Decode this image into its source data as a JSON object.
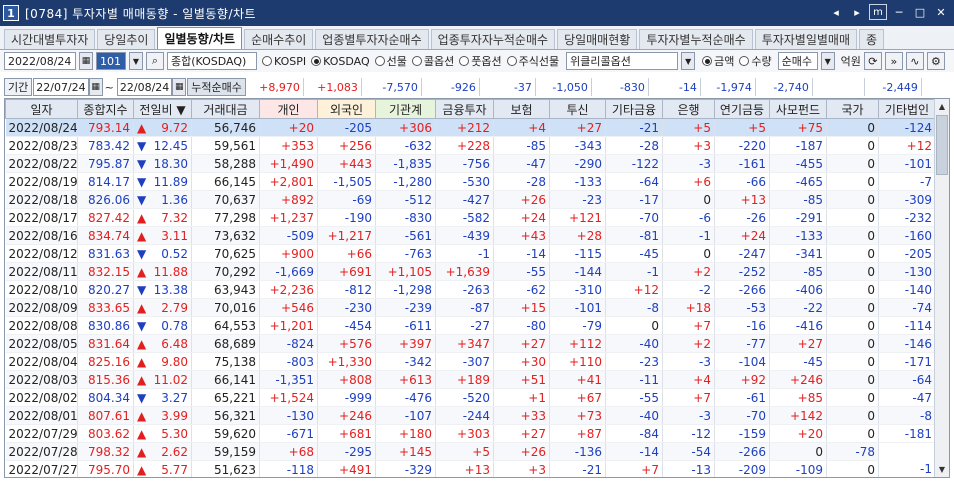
{
  "window": {
    "badge": "1",
    "title": "[0784] 투자자별 매매동향 - 일별동향/차트"
  },
  "tabs": [
    "시간대별투자자",
    "당일추이",
    "일별동향/차트",
    "순매수추이",
    "업종별투자자순매수",
    "업종투자자누적순매수",
    "당일매매현황",
    "투자자별누적순매수",
    "투자자별일별매매",
    "종"
  ],
  "active_tab": 2,
  "toolbar": {
    "date": "2022/08/24",
    "code": "101",
    "market_name": "종합(KOSDAQ)",
    "radios": [
      {
        "label": "KOSPI",
        "on": false
      },
      {
        "label": "KOSDAQ",
        "on": true
      },
      {
        "label": "선물",
        "on": false
      },
      {
        "label": "콜옵션",
        "on": false
      },
      {
        "label": "풋옵션",
        "on": false
      },
      {
        "label": "주식선물",
        "on": false
      }
    ],
    "weekly_option": "위클리콜옵션",
    "amount_radios": [
      {
        "label": "금액",
        "on": true
      },
      {
        "label": "수량",
        "on": false
      }
    ],
    "sort_select": "순매수",
    "unit": "억원"
  },
  "range": {
    "label": "기간",
    "from": "22/07/24",
    "sep": "~",
    "to": "22/08/24",
    "cum_label": "누적순매수",
    "sums": [
      "+8,970",
      "+1,083",
      "-7,570",
      "-926",
      "-37",
      "-1,050",
      "-830",
      "-14",
      "-1,974",
      "-2,740",
      "",
      "-2,449"
    ]
  },
  "columns": [
    "일자",
    "종합지수",
    "전일비",
    "거래대금",
    "개인",
    "외국인",
    "기관계",
    "금융투자",
    "보험",
    "투신",
    "기타금융",
    "은행",
    "연기금등",
    "사모펀드",
    "국가",
    "기타법인"
  ],
  "rows": [
    [
      "2022/08/24",
      "793.14",
      "▲",
      "9.72",
      "56,746",
      "+20",
      "-205",
      "+306",
      "+212",
      "+4",
      "+27",
      "-21",
      "+5",
      "+5",
      "+75",
      "0",
      "-124"
    ],
    [
      "2022/08/23",
      "783.42",
      "▼",
      "12.45",
      "59,561",
      "+353",
      "+256",
      "-632",
      "+228",
      "-85",
      "-343",
      "-28",
      "+3",
      "-220",
      "-187",
      "0",
      "+12"
    ],
    [
      "2022/08/22",
      "795.87",
      "▼",
      "18.30",
      "58,288",
      "+1,490",
      "+443",
      "-1,835",
      "-756",
      "-47",
      "-290",
      "-122",
      "-3",
      "-161",
      "-455",
      "0",
      "-101"
    ],
    [
      "2022/08/19",
      "814.17",
      "▼",
      "11.89",
      "66,145",
      "+2,801",
      "-1,505",
      "-1,280",
      "-530",
      "-28",
      "-133",
      "-64",
      "+6",
      "-66",
      "-465",
      "0",
      "-7"
    ],
    [
      "2022/08/18",
      "826.06",
      "▼",
      "1.36",
      "70,637",
      "+892",
      "-69",
      "-512",
      "-427",
      "+26",
      "-23",
      "-17",
      "0",
      "+13",
      "-85",
      "0",
      "-309"
    ],
    [
      "2022/08/17",
      "827.42",
      "▲",
      "7.32",
      "77,298",
      "+1,237",
      "-190",
      "-830",
      "-582",
      "+24",
      "+121",
      "-70",
      "-6",
      "-26",
      "-291",
      "0",
      "-232"
    ],
    [
      "2022/08/16",
      "834.74",
      "▲",
      "3.11",
      "73,632",
      "-509",
      "+1,217",
      "-561",
      "-439",
      "+43",
      "+28",
      "-81",
      "-1",
      "+24",
      "-133",
      "0",
      "-160"
    ],
    [
      "2022/08/12",
      "831.63",
      "▼",
      "0.52",
      "70,625",
      "+900",
      "+66",
      "-763",
      "-1",
      "-14",
      "-115",
      "-45",
      "0",
      "-247",
      "-341",
      "0",
      "-205"
    ],
    [
      "2022/08/11",
      "832.15",
      "▲",
      "11.88",
      "70,292",
      "-1,669",
      "+691",
      "+1,105",
      "+1,639",
      "-55",
      "-144",
      "-1",
      "+2",
      "-252",
      "-85",
      "0",
      "-130"
    ],
    [
      "2022/08/10",
      "820.27",
      "▼",
      "13.38",
      "63,943",
      "+2,236",
      "-812",
      "-1,298",
      "-263",
      "-62",
      "-310",
      "+12",
      "-2",
      "-266",
      "-406",
      "0",
      "-140"
    ],
    [
      "2022/08/09",
      "833.65",
      "▲",
      "2.79",
      "70,016",
      "+546",
      "-230",
      "-239",
      "-87",
      "+15",
      "-101",
      "-8",
      "+18",
      "-53",
      "-22",
      "0",
      "-74"
    ],
    [
      "2022/08/08",
      "830.86",
      "▼",
      "0.78",
      "64,553",
      "+1,201",
      "-454",
      "-611",
      "-27",
      "-80",
      "-79",
      "0",
      "+7",
      "-16",
      "-416",
      "0",
      "-114"
    ],
    [
      "2022/08/05",
      "831.64",
      "▲",
      "6.48",
      "68,689",
      "-824",
      "+576",
      "+397",
      "+347",
      "+27",
      "+112",
      "-40",
      "+2",
      "-77",
      "+27",
      "0",
      "-146"
    ],
    [
      "2022/08/04",
      "825.16",
      "▲",
      "9.80",
      "75,138",
      "-803",
      "+1,330",
      "-342",
      "-307",
      "+30",
      "+110",
      "-23",
      "-3",
      "-104",
      "-45",
      "0",
      "-171"
    ],
    [
      "2022/08/03",
      "815.36",
      "▲",
      "11.02",
      "66,141",
      "-1,351",
      "+808",
      "+613",
      "+189",
      "+51",
      "+41",
      "-11",
      "+4",
      "+92",
      "+246",
      "0",
      "-64"
    ],
    [
      "2022/08/02",
      "804.34",
      "▼",
      "3.27",
      "65,221",
      "+1,524",
      "-999",
      "-476",
      "-520",
      "+1",
      "+67",
      "-55",
      "+7",
      "-61",
      "+85",
      "0",
      "-47"
    ],
    [
      "2022/08/01",
      "807.61",
      "▲",
      "3.99",
      "56,321",
      "-130",
      "+246",
      "-107",
      "-244",
      "+33",
      "+73",
      "-40",
      "-3",
      "-70",
      "+142",
      "0",
      "-8"
    ],
    [
      "2022/07/29",
      "803.62",
      "▲",
      "5.30",
      "59,620",
      "-671",
      "+681",
      "+180",
      "+303",
      "+27",
      "+87",
      "-84",
      "-12",
      "-159",
      "+20",
      "0",
      "-181"
    ],
    [
      "2022/07/28",
      "798.32",
      "▲",
      "2.62",
      "59,159",
      "+68",
      "-295",
      "+145",
      "+5",
      "+26",
      "-136",
      "-14",
      "-54",
      "-266",
      "0",
      "-78"
    ],
    [
      "2022/07/27",
      "795.70",
      "▲",
      "5.77",
      "51,623",
      "-118",
      "+491",
      "-329",
      "+13",
      "+3",
      "-21",
      "+7",
      "-13",
      "-209",
      "-109",
      "0",
      "-1"
    ]
  ]
}
